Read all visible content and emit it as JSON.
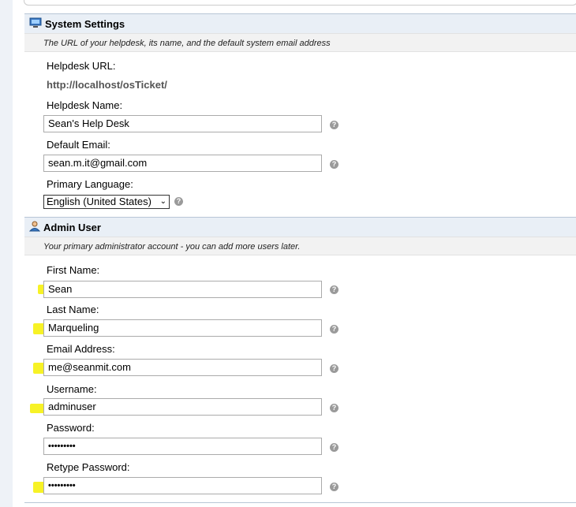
{
  "system_settings": {
    "title": "System Settings",
    "description": "The URL of your helpdesk, its name, and the default system email address",
    "helpdesk_url_label": "Helpdesk URL:",
    "helpdesk_url_value": "http://localhost/osTicket/",
    "helpdesk_name_label": "Helpdesk Name:",
    "helpdesk_name_value": "Sean's Help Desk",
    "default_email_label": "Default Email:",
    "default_email_value": "sean.m.it@gmail.com",
    "primary_language_label": "Primary Language:",
    "primary_language_value": "English (United States)"
  },
  "admin_user": {
    "title": "Admin User",
    "description": "Your primary administrator account - you can add more users later.",
    "first_name_label": "First Name:",
    "first_name_value": "Sean",
    "last_name_label": "Last Name:",
    "last_name_value": "Marqueling",
    "email_label": "Email Address:",
    "email_value": "me@seanmit.com",
    "username_label": "Username:",
    "username_value": "adminuser",
    "password_label": "Password:",
    "password_value": "•••••••••",
    "retype_password_label": "Retype Password:",
    "retype_password_value": "•••••••••"
  },
  "help_icon_glyph": "?",
  "select_chevron": "⌄",
  "colors": {
    "header_bg": "#e9eff6",
    "highlight": "#f6f000"
  }
}
